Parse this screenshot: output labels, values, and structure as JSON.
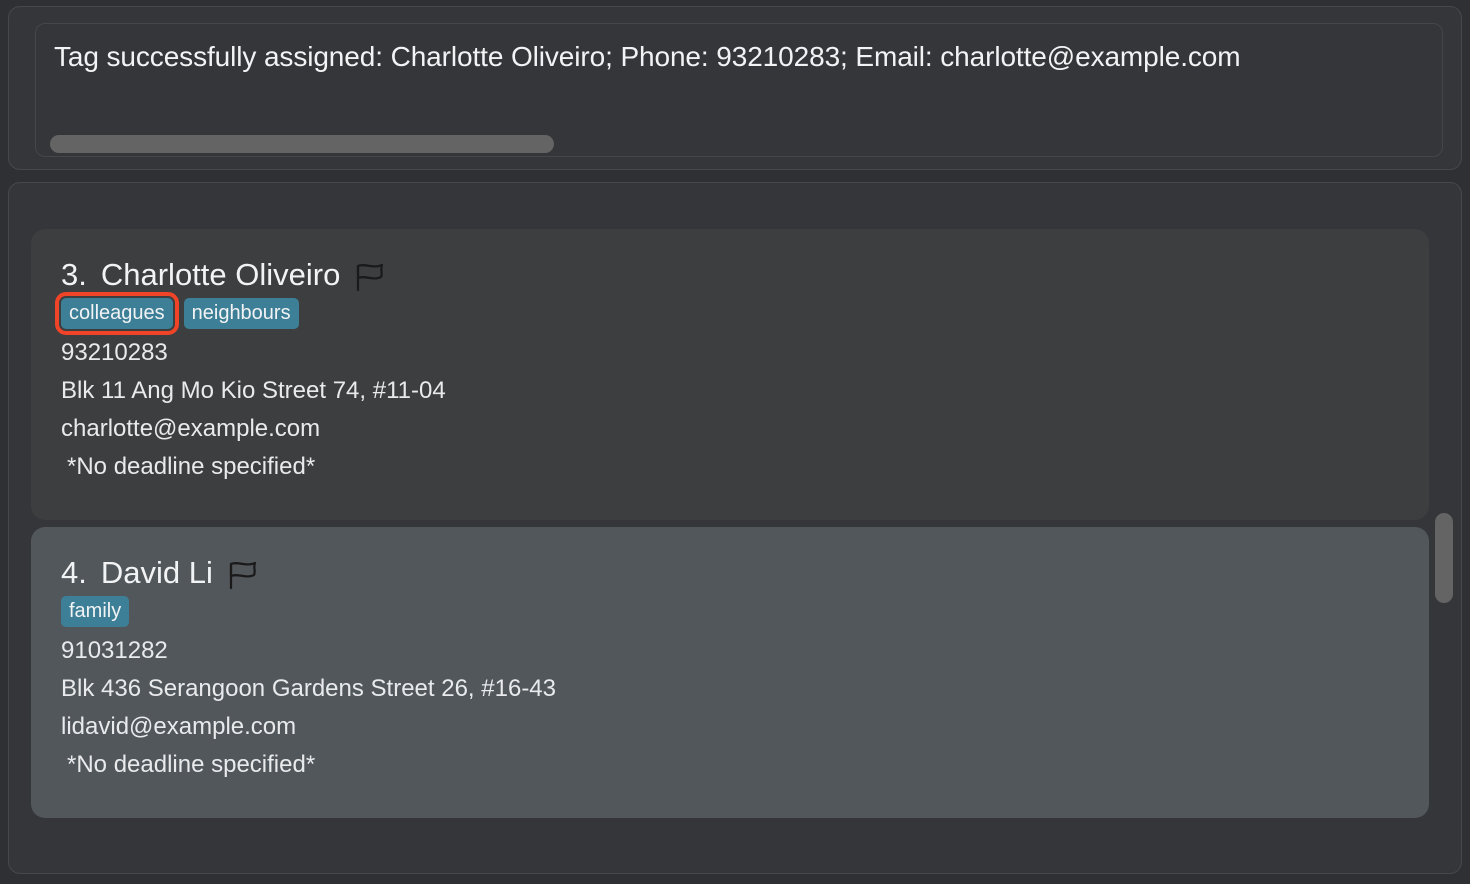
{
  "result_panel": {
    "message": "Tag successfully assigned: Charlotte Oliveiro; Phone: 93210283; Email: charlotte@example.com",
    "hscrollbar_name": "horizontal-scrollbar"
  },
  "list_panel": {
    "contacts": [
      {
        "index": "3.",
        "name": "Charlotte Oliveiro",
        "flag_icon": "flag-icon",
        "selected": false,
        "tags": [
          {
            "label": "colleagues",
            "highlighted": true
          },
          {
            "label": "neighbours",
            "highlighted": false
          }
        ],
        "phone": "93210283",
        "address": "Blk 11 Ang Mo Kio Street 74, #11-04",
        "email": "charlotte@example.com",
        "deadline": "*No deadline specified*"
      },
      {
        "index": "4.",
        "name": "David Li",
        "flag_icon": "flag-icon",
        "selected": true,
        "tags": [
          {
            "label": "family",
            "highlighted": false
          }
        ],
        "phone": "91031282",
        "address": "Blk 436 Serangoon Gardens Street 26, #16-43",
        "email": "lidavid@example.com",
        "deadline": "*No deadline specified*"
      }
    ]
  },
  "colors": {
    "app_background": "#2e3033",
    "panel_background": "#34363a",
    "card_background": "#3c3e40",
    "card_selected_background": "#52575b",
    "tag_background": "#3d7f96",
    "tag_highlight_border": "#f04428",
    "text_primary": "#f2f3f4",
    "scrollbar_thumb": "#646464"
  }
}
